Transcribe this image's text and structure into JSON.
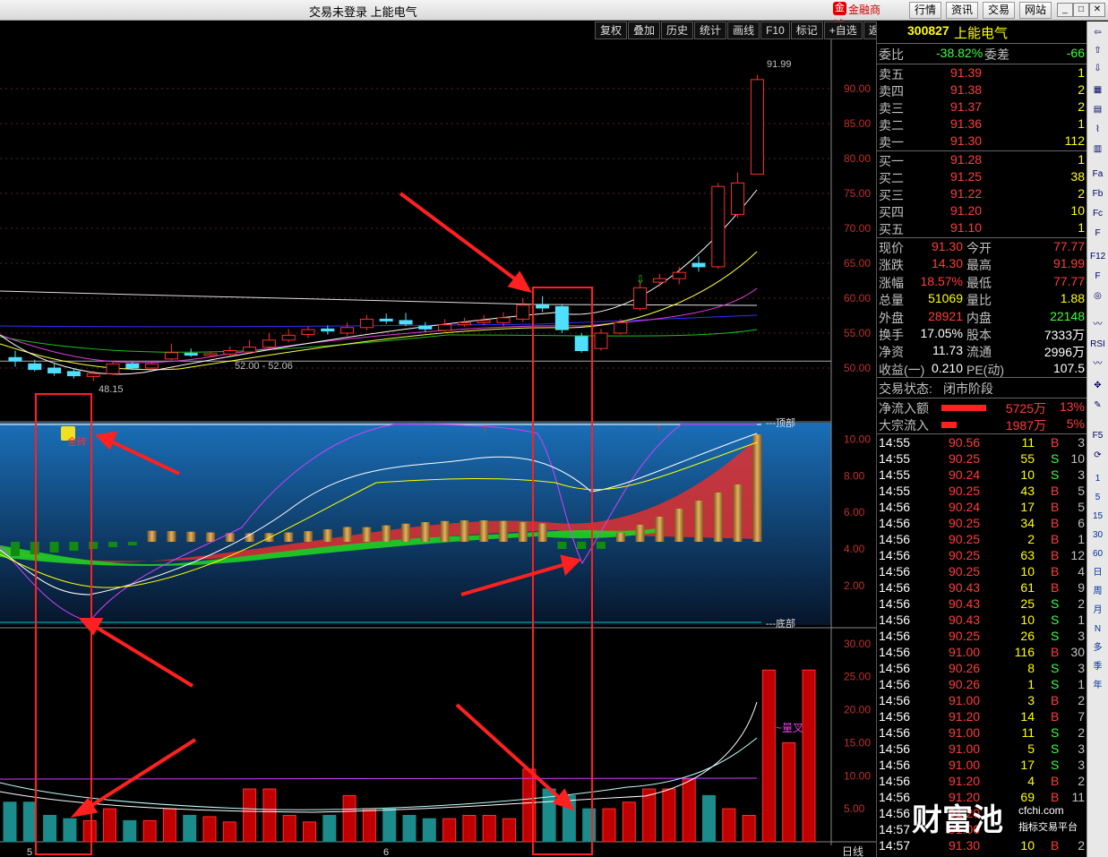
{
  "window": {
    "title": "交易未登录 上能电气",
    "brand": "金融商城",
    "nav": [
      "行情",
      "资讯",
      "交易",
      "网站"
    ]
  },
  "toolbar": [
    "复权",
    "叠加",
    "历史",
    "统计",
    "画线",
    "F10",
    "标记",
    "+自选",
    "返回"
  ],
  "stock": {
    "code": "300827",
    "name": "上能电气"
  },
  "order_ratio": {
    "label1": "委比",
    "value1": "-38.82%",
    "label2": "委差",
    "value2": "-66"
  },
  "asks": [
    {
      "label": "卖五",
      "price": "91.39",
      "vol": "1"
    },
    {
      "label": "卖四",
      "price": "91.38",
      "vol": "2"
    },
    {
      "label": "卖三",
      "price": "91.37",
      "vol": "2"
    },
    {
      "label": "卖二",
      "price": "91.36",
      "vol": "1"
    },
    {
      "label": "卖一",
      "price": "91.30",
      "vol": "112"
    }
  ],
  "bids": [
    {
      "label": "买一",
      "price": "91.28",
      "vol": "1"
    },
    {
      "label": "买二",
      "price": "91.25",
      "vol": "38"
    },
    {
      "label": "买三",
      "price": "91.22",
      "vol": "2"
    },
    {
      "label": "买四",
      "price": "91.20",
      "vol": "10"
    },
    {
      "label": "买五",
      "price": "91.10",
      "vol": "1"
    }
  ],
  "quote": [
    {
      "l1": "现价",
      "v1": "91.30",
      "l2": "今开",
      "v2": "77.77"
    },
    {
      "l1": "涨跌",
      "v1": "14.30",
      "l2": "最高",
      "v2": "91.99"
    },
    {
      "l1": "涨幅",
      "v1": "18.57%",
      "l2": "最低",
      "v2": "77.77"
    },
    {
      "l1": "总量",
      "v1": "51069",
      "l2": "量比",
      "v2": "1.88"
    },
    {
      "l1": "外盘",
      "v1": "28921",
      "l2": "内盘",
      "v2": "22148"
    },
    {
      "l1": "换手",
      "v1": "17.05%",
      "l2": "股本",
      "v2": "7333万"
    },
    {
      "l1": "净资",
      "v1": "11.73",
      "l2": "流通",
      "v2": "2996万"
    },
    {
      "l1": "收益(一)",
      "v1": "0.210",
      "l2": "PE(动)",
      "v2": "107.5"
    }
  ],
  "status": {
    "label": "交易状态:",
    "value": "闭市阶段"
  },
  "flows": [
    {
      "label": "净流入额",
      "amount": "5725万",
      "pct": "13%",
      "bar": 0.9
    },
    {
      "label": "大宗流入",
      "amount": "1987万",
      "pct": "5%",
      "bar": 0.3
    }
  ],
  "ticks": [
    {
      "t": "14:55",
      "p": "90.56",
      "v": "11",
      "s": "B",
      "n": "3"
    },
    {
      "t": "14:55",
      "p": "90.25",
      "v": "55",
      "s": "S",
      "n": "10"
    },
    {
      "t": "14:55",
      "p": "90.24",
      "v": "10",
      "s": "S",
      "n": "3"
    },
    {
      "t": "14:55",
      "p": "90.25",
      "v": "43",
      "s": "B",
      "n": "5"
    },
    {
      "t": "14:56",
      "p": "90.24",
      "v": "17",
      "s": "B",
      "n": "5"
    },
    {
      "t": "14:56",
      "p": "90.25",
      "v": "34",
      "s": "B",
      "n": "6"
    },
    {
      "t": "14:56",
      "p": "90.25",
      "v": "2",
      "s": "B",
      "n": "1"
    },
    {
      "t": "14:56",
      "p": "90.25",
      "v": "63",
      "s": "B",
      "n": "12"
    },
    {
      "t": "14:56",
      "p": "90.25",
      "v": "10",
      "s": "B",
      "n": "4"
    },
    {
      "t": "14:56",
      "p": "90.43",
      "v": "61",
      "s": "B",
      "n": "9"
    },
    {
      "t": "14:56",
      "p": "90.43",
      "v": "25",
      "s": "S",
      "n": "2"
    },
    {
      "t": "14:56",
      "p": "90.43",
      "v": "10",
      "s": "S",
      "n": "1"
    },
    {
      "t": "14:56",
      "p": "90.25",
      "v": "26",
      "s": "S",
      "n": "3"
    },
    {
      "t": "14:56",
      "p": "91.00",
      "v": "116",
      "s": "B",
      "n": "30"
    },
    {
      "t": "14:56",
      "p": "90.26",
      "v": "8",
      "s": "S",
      "n": "3"
    },
    {
      "t": "14:56",
      "p": "90.26",
      "v": "1",
      "s": "S",
      "n": "1"
    },
    {
      "t": "14:56",
      "p": "91.00",
      "v": "3",
      "s": "B",
      "n": "2"
    },
    {
      "t": "14:56",
      "p": "91.20",
      "v": "14",
      "s": "B",
      "n": "7"
    },
    {
      "t": "14:56",
      "p": "91.00",
      "v": "11",
      "s": "S",
      "n": "2"
    },
    {
      "t": "14:56",
      "p": "91.00",
      "v": "5",
      "s": "S",
      "n": "3"
    },
    {
      "t": "14:56",
      "p": "91.00",
      "v": "17",
      "s": "S",
      "n": "3"
    },
    {
      "t": "14:56",
      "p": "91.20",
      "v": "4",
      "s": "B",
      "n": "2"
    },
    {
      "t": "14:56",
      "p": "91.20",
      "v": "69",
      "s": "B",
      "n": "11"
    },
    {
      "t": "14:56",
      "p": "91.20",
      "v": "",
      "s": "",
      "n": ""
    },
    {
      "t": "14:57",
      "p": "91.00",
      "v": "",
      "s": "",
      "n": ""
    },
    {
      "t": "14:57",
      "p": "91.30",
      "v": "10",
      "s": "B",
      "n": "2"
    }
  ],
  "side_tools": [
    "1",
    "5",
    "15",
    "30",
    "60",
    "日",
    "周",
    "月",
    "N",
    "多",
    "季",
    "年"
  ],
  "watermark": {
    "main": "财富池",
    "site": "cfchi.com",
    "sub": "指标交易平台"
  },
  "chart_data": [
    {
      "type": "candlestick",
      "price_axis": [
        "90.00",
        "85.00",
        "80.00",
        "75.00",
        "70.00",
        "65.00",
        "60.00",
        "55.00",
        "50.00"
      ],
      "ylim": [
        45,
        95
      ],
      "annotations": {
        "high": "91.99",
        "low": "48.15",
        "range": "52.00 - 52.06"
      },
      "candles": [
        {
          "o": 51.5,
          "c": 51.0,
          "h": 52.5,
          "l": 50.2
        },
        {
          "o": 50.6,
          "c": 49.8,
          "h": 51.2,
          "l": 49.5
        },
        {
          "o": 50.0,
          "c": 49.3,
          "h": 50.6,
          "l": 48.9
        },
        {
          "o": 49.5,
          "c": 48.9,
          "h": 50.0,
          "l": 48.5
        },
        {
          "o": 48.8,
          "c": 49.2,
          "h": 49.6,
          "l": 48.15
        },
        {
          "o": 49.2,
          "c": 50.6,
          "h": 51.0,
          "l": 49.0
        },
        {
          "o": 50.6,
          "c": 50.0,
          "h": 50.9,
          "l": 49.7
        },
        {
          "o": 50.0,
          "c": 50.6,
          "h": 51.0,
          "l": 49.7
        },
        {
          "o": 51.3,
          "c": 52.2,
          "h": 53.5,
          "l": 51.1
        },
        {
          "o": 52.1,
          "c": 52.06,
          "h": 52.8,
          "l": 51.6
        },
        {
          "o": 52.0,
          "c": 52.06,
          "h": 52.4,
          "l": 51.5
        },
        {
          "o": 52.0,
          "c": 52.5,
          "h": 53.1,
          "l": 51.8
        },
        {
          "o": 52.3,
          "c": 53.0,
          "h": 54.0,
          "l": 52.0
        },
        {
          "o": 53.0,
          "c": 54.0,
          "h": 55.0,
          "l": 52.7
        },
        {
          "o": 54.0,
          "c": 54.7,
          "h": 55.6,
          "l": 53.7
        },
        {
          "o": 54.8,
          "c": 55.5,
          "h": 56.0,
          "l": 54.3
        },
        {
          "o": 55.6,
          "c": 55.3,
          "h": 56.1,
          "l": 54.8
        },
        {
          "o": 55.0,
          "c": 55.8,
          "h": 56.5,
          "l": 54.6
        },
        {
          "o": 55.8,
          "c": 57.0,
          "h": 57.6,
          "l": 55.4
        },
        {
          "o": 57.0,
          "c": 56.9,
          "h": 57.8,
          "l": 56.3
        },
        {
          "o": 56.8,
          "c": 56.3,
          "h": 57.9,
          "l": 56.0
        },
        {
          "o": 56.0,
          "c": 55.6,
          "h": 56.6,
          "l": 55.2
        },
        {
          "o": 55.4,
          "c": 56.2,
          "h": 57.0,
          "l": 55.0
        },
        {
          "o": 56.2,
          "c": 56.5,
          "h": 57.2,
          "l": 55.9
        },
        {
          "o": 56.5,
          "c": 56.8,
          "h": 57.6,
          "l": 56.1
        },
        {
          "o": 56.5,
          "c": 57.2,
          "h": 58.0,
          "l": 56.0
        },
        {
          "o": 57.0,
          "c": 59.0,
          "h": 60.0,
          "l": 56.6
        },
        {
          "o": 59.0,
          "c": 58.6,
          "h": 60.3,
          "l": 58.0
        },
        {
          "o": 58.8,
          "c": 55.5,
          "h": 59.2,
          "l": 55.0
        },
        {
          "o": 54.5,
          "c": 52.5,
          "h": 55.0,
          "l": 52.2
        },
        {
          "o": 52.8,
          "c": 55.0,
          "h": 55.6,
          "l": 52.5
        },
        {
          "o": 55.0,
          "c": 56.5,
          "h": 57.0,
          "l": 54.8
        },
        {
          "o": 58.5,
          "c": 61.5,
          "h": 62.5,
          "l": 58.2
        },
        {
          "o": 62.3,
          "c": 62.8,
          "h": 63.5,
          "l": 61.7
        },
        {
          "o": 62.8,
          "c": 63.7,
          "h": 64.5,
          "l": 62.0
        },
        {
          "o": 65.0,
          "c": 64.5,
          "h": 66.0,
          "l": 63.8
        },
        {
          "o": 64.5,
          "c": 76.0,
          "h": 76.5,
          "l": 64.2
        },
        {
          "o": 72.0,
          "c": 76.5,
          "h": 78.0,
          "l": 71.5
        },
        {
          "o": 77.77,
          "c": 91.3,
          "h": 91.99,
          "l": 77.77
        }
      ]
    },
    {
      "type": "indicator",
      "y_axis": [
        "10.00",
        "8.00",
        "6.00",
        "4.00",
        "2.00"
      ],
      "ylim": [
        0,
        10.8
      ],
      "labels": {
        "top": "---顶部",
        "bottom": "---底部",
        "signal": "金砖"
      }
    },
    {
      "type": "bar",
      "y_axis": [
        "30.00",
        "25.00",
        "20.00",
        "15.00",
        "10.00",
        "5.00"
      ],
      "ylim": [
        0,
        32
      ],
      "labels": {
        "series": "~量叉"
      },
      "values": [
        6,
        6,
        4,
        3.5,
        3.2,
        5,
        3.2,
        3.2,
        5,
        4,
        3.8,
        3,
        8,
        8,
        4,
        3,
        4,
        7,
        5,
        5,
        4,
        3.5,
        3.5,
        4,
        4,
        3.5,
        11,
        8,
        7,
        5,
        5,
        6,
        8,
        8,
        9.5,
        7,
        5,
        4,
        26,
        15,
        26
      ]
    }
  ],
  "x_axis": {
    "labels": [
      "5",
      "6"
    ],
    "period": "日线"
  }
}
